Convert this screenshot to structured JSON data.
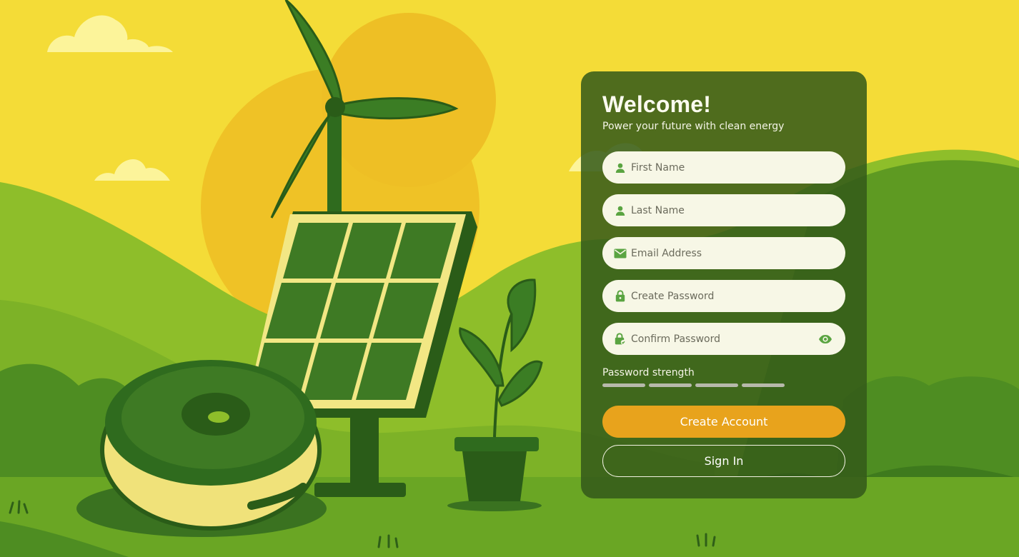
{
  "panel": {
    "title": "Welcome!",
    "subtitle": "Power your future with clean energy"
  },
  "form": {
    "first_name": {
      "placeholder": "First Name",
      "value": "",
      "icon": "person-icon"
    },
    "last_name": {
      "placeholder": "Last Name",
      "value": "",
      "icon": "person-icon"
    },
    "email": {
      "placeholder": "Email Address",
      "value": "",
      "icon": "envelope-icon"
    },
    "password": {
      "placeholder": "Create Password",
      "value": "",
      "icon": "lock-icon"
    },
    "confirm_password": {
      "placeholder": "Confirm Password",
      "value": "",
      "icon": "lock-check-icon",
      "toggle_icon": "eye-icon"
    },
    "strength_label": "Password strength",
    "strength_level": 0,
    "strength_segments": 4
  },
  "actions": {
    "create_account": "Create Account",
    "sign_in": "Sign In"
  },
  "colors": {
    "sky": "#f4dc37",
    "sun": "#eec125",
    "hill_light": "#8fc02a",
    "hill_dark": "#4f8f1f",
    "panel": "#335a1a",
    "field_bg": "#f7f7e6",
    "icon_green": "#5aa441",
    "primary": "#e8a31c",
    "strength_empty": "#b7b9ab"
  },
  "illustration": {
    "elements": [
      "cloud",
      "sun",
      "wind-turbine",
      "solar-panel",
      "robot-vacuum",
      "potted-plant",
      "hills",
      "grass-tufts"
    ]
  }
}
